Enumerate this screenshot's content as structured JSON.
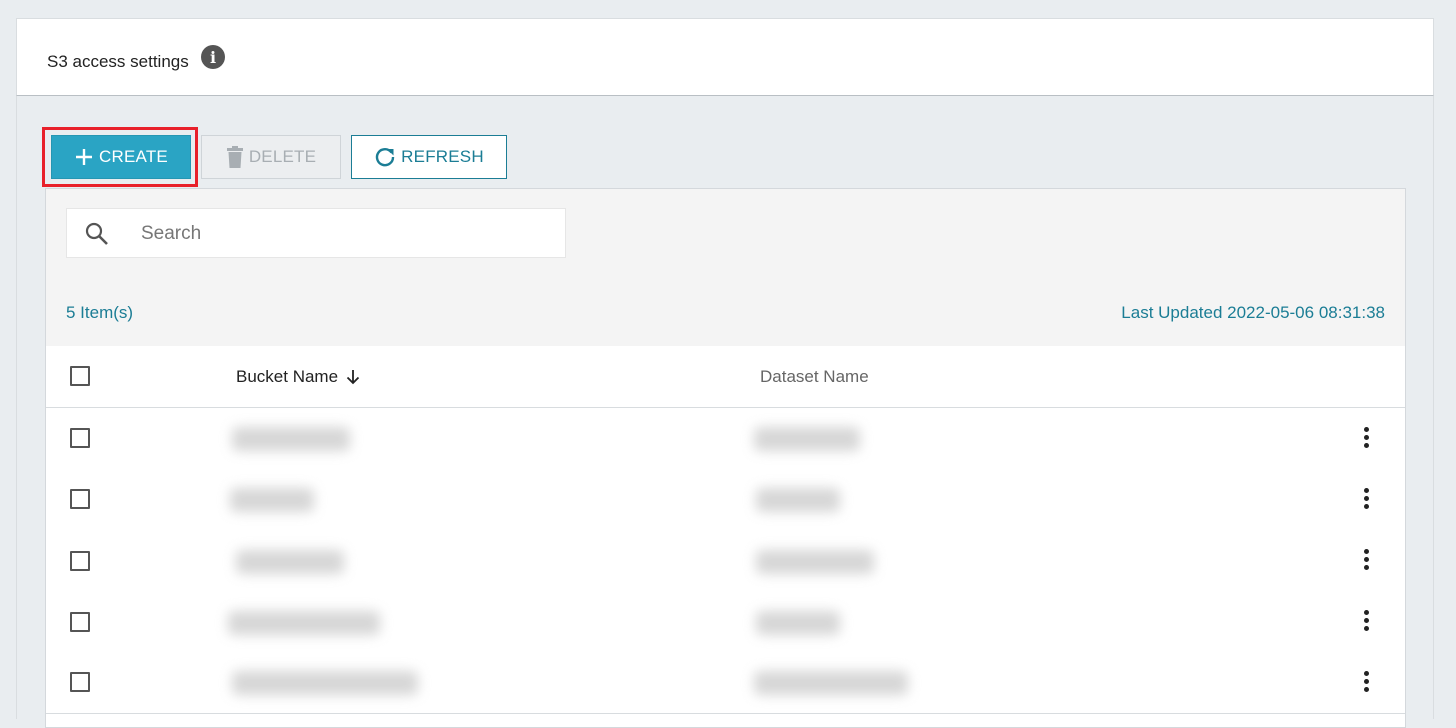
{
  "panel": {
    "title": "S3 access settings",
    "info_icon": "info-icon"
  },
  "toolbar": {
    "create_label": "CREATE",
    "delete_label": "DELETE",
    "refresh_label": "REFRESH",
    "accent_color": "#2aa4c4",
    "highlight_color": "#e8202a"
  },
  "search": {
    "placeholder": "Search",
    "value": ""
  },
  "table": {
    "item_count": "5 Item(s)",
    "last_updated": "Last Updated 2022-05-06 08:31:38",
    "columns": [
      "Bucket Name",
      "Dataset Name"
    ],
    "sort": {
      "column": "Bucket Name",
      "direction": "descending",
      "icon": "arrow-down-icon"
    },
    "rows": [
      {
        "bucket_name": "",
        "dataset_name": "",
        "redacted": true
      },
      {
        "bucket_name": "",
        "dataset_name": "",
        "redacted": true
      },
      {
        "bucket_name": "",
        "dataset_name": "",
        "redacted": true
      },
      {
        "bucket_name": "",
        "dataset_name": "",
        "redacted": true
      },
      {
        "bucket_name": "",
        "dataset_name": "",
        "redacted": true
      }
    ]
  }
}
